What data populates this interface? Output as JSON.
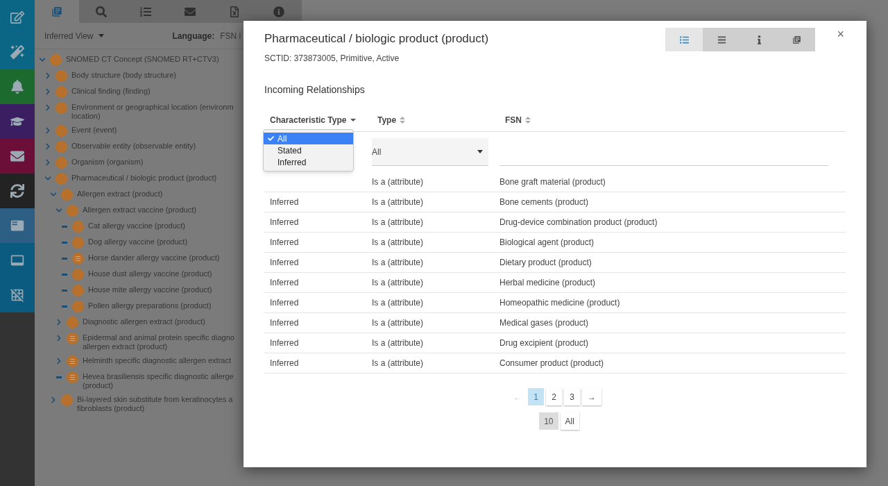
{
  "sidebar": {
    "items": [
      {
        "color": "#0b6585"
      },
      {
        "color": "#0b6585"
      },
      {
        "color": "#1d6a2f"
      },
      {
        "color": "#3b1d62"
      },
      {
        "color": "#6b0f38"
      },
      {
        "color": "#232323"
      },
      {
        "color": "#2d5f84"
      },
      {
        "color": "#0b5a80"
      },
      {
        "color": "#0b5a80"
      }
    ]
  },
  "panel_tabs": [
    {
      "selected": true
    },
    {
      "selected": false
    },
    {
      "selected": false
    },
    {
      "selected": false
    },
    {
      "selected": false
    },
    {
      "selected": false
    }
  ],
  "view_menu": {
    "label": "Inferred View"
  },
  "language": {
    "label": "Language:",
    "value": "FSN i"
  },
  "tree": [
    {
      "label": "SNOMED CT Concept (SNOMED RT+CTV3)",
      "kind": "branch",
      "expanded": true,
      "defined": false,
      "children": [
        {
          "label": "Body structure (body structure)",
          "kind": "branch",
          "expanded": false,
          "defined": false
        },
        {
          "label": "Clinical finding (finding)",
          "kind": "branch",
          "expanded": false,
          "defined": false
        },
        {
          "label": "Environment or geographical location (environm\nlocation)",
          "kind": "branch",
          "expanded": false,
          "defined": false
        },
        {
          "label": "Event (event)",
          "kind": "branch",
          "expanded": false,
          "defined": false
        },
        {
          "label": "Observable entity (observable entity)",
          "kind": "branch",
          "expanded": false,
          "defined": false
        },
        {
          "label": "Organism (organism)",
          "kind": "branch",
          "expanded": false,
          "defined": false
        },
        {
          "label": "Pharmaceutical / biologic product (product)",
          "kind": "branch",
          "expanded": true,
          "defined": false,
          "children": [
            {
              "label": "Allergen extract (product)",
              "kind": "branch",
              "expanded": true,
              "defined": false,
              "children": [
                {
                  "label": "Allergen extract vaccine (product)",
                  "kind": "branch",
                  "expanded": true,
                  "defined": false,
                  "children": [
                    {
                      "label": "Cat allergy vaccine (product)",
                      "kind": "leaf",
                      "defined": false
                    },
                    {
                      "label": "Dog allergy vaccine (product)",
                      "kind": "leaf",
                      "defined": false
                    },
                    {
                      "label": "Horse dander allergy vaccine (product)",
                      "kind": "leaf",
                      "defined": true
                    },
                    {
                      "label": "House dust allergy vaccine (product)",
                      "kind": "leaf",
                      "defined": false
                    },
                    {
                      "label": "House mite allergy vaccine (product)",
                      "kind": "leaf",
                      "defined": false
                    },
                    {
                      "label": "Pollen allergy preparations (product)",
                      "kind": "leaf",
                      "defined": false
                    }
                  ]
                },
                {
                  "label": "Diagnostic allergen extract (product)",
                  "kind": "branch",
                  "expanded": false,
                  "defined": false
                },
                {
                  "label": "Epidermal and animal protein specific diagno\nallergen extract (product)",
                  "kind": "branch",
                  "expanded": false,
                  "defined": true
                },
                {
                  "label": "Helminth specific diagnostic allergen extract",
                  "kind": "branch",
                  "expanded": false,
                  "defined": true
                },
                {
                  "label": "Hevea brasiliensis specific diagnostic allerge\n(product)",
                  "kind": "leaf",
                  "defined": true
                }
              ]
            },
            {
              "label": "Bi-layered skin substitute from keratinocytes a\nfibroblasts (product)",
              "kind": "branch",
              "expanded": false,
              "defined": false
            }
          ]
        }
      ]
    }
  ],
  "modal": {
    "title": "Pharmaceutical / biologic product (product)",
    "subtitle": "SCTID: 373873005, Primitive, Active",
    "view_buttons": [
      {
        "selected": true
      },
      {
        "selected": false
      },
      {
        "selected": false
      },
      {
        "selected": false
      }
    ],
    "close": "×",
    "section_title": "Incoming Relationships",
    "columns": [
      {
        "label": "Characteristic Type",
        "sorted": true
      },
      {
        "label": "Type",
        "sorted": false
      },
      {
        "label": "FSN",
        "sorted": false
      }
    ],
    "type_filter": {
      "value": "All"
    },
    "characteristic_dropdown": {
      "options": [
        {
          "label": "All",
          "selected": true
        },
        {
          "label": "Stated",
          "selected": false
        },
        {
          "label": "Inferred",
          "selected": false
        }
      ]
    },
    "rows": [
      {
        "type": "Is a (attribute)",
        "fsn": "Bone graft material (product)"
      },
      {
        "characteristic_type": "Inferred",
        "type": "Is a (attribute)",
        "fsn": "Bone cements (product)"
      },
      {
        "characteristic_type": "Inferred",
        "type": "Is a (attribute)",
        "fsn": "Drug-device combination product (product)"
      },
      {
        "characteristic_type": "Inferred",
        "type": "Is a (attribute)",
        "fsn": "Biological agent (product)"
      },
      {
        "characteristic_type": "Inferred",
        "type": "Is a (attribute)",
        "fsn": "Dietary product (product)"
      },
      {
        "characteristic_type": "Inferred",
        "type": "Is a (attribute)",
        "fsn": "Herbal medicine (product)"
      },
      {
        "characteristic_type": "Inferred",
        "type": "Is a (attribute)",
        "fsn": "Homeopathic medicine (product)"
      },
      {
        "characteristic_type": "Inferred",
        "type": "Is a (attribute)",
        "fsn": "Medical gases (product)"
      },
      {
        "characteristic_type": "Inferred",
        "type": "Is a (attribute)",
        "fsn": "Drug excipient (product)"
      },
      {
        "characteristic_type": "Inferred",
        "type": "Is a (attribute)",
        "fsn": "Consumer product (product)"
      }
    ],
    "pagination": {
      "prev": "←",
      "pages": [
        {
          "label": "1",
          "selected": true
        },
        {
          "label": "2",
          "selected": false
        },
        {
          "label": "3",
          "selected": false
        }
      ],
      "next": "→",
      "prev_disabled": true
    },
    "page_sizes": [
      {
        "label": "10",
        "selected": true
      },
      {
        "label": "All",
        "selected": false
      }
    ]
  }
}
